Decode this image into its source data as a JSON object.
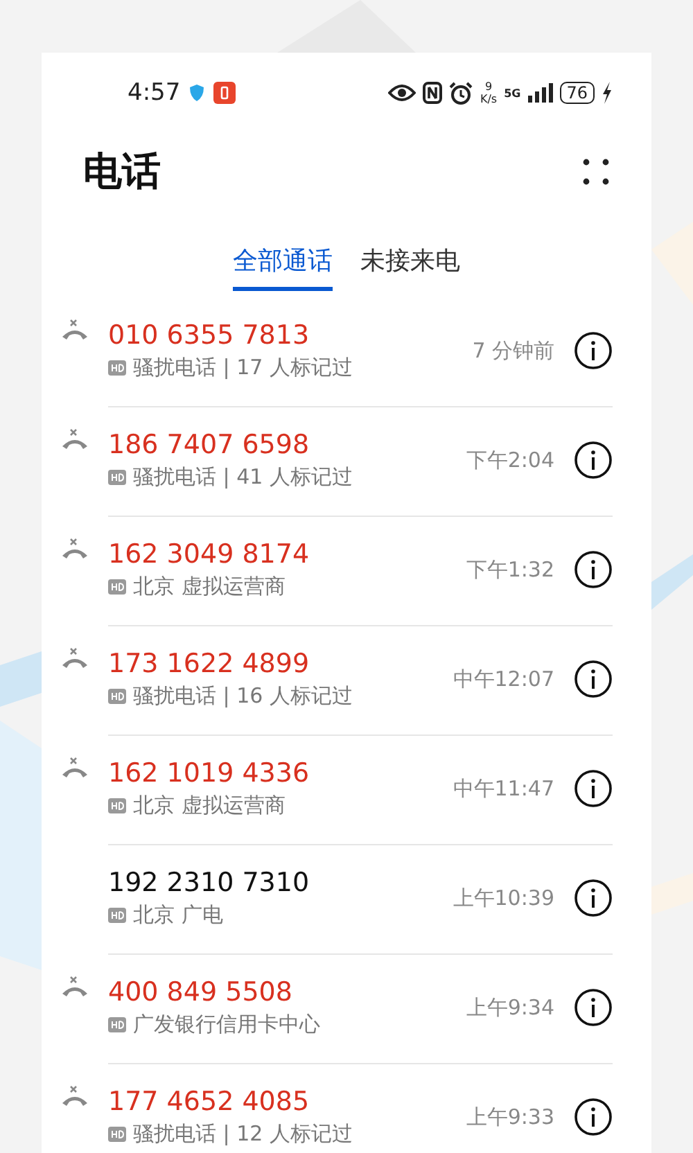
{
  "status_bar": {
    "time": "4:57",
    "speed_value": "9",
    "speed_unit": "K/s",
    "network": "5G",
    "battery": "76"
  },
  "title": "电话",
  "tabs": [
    {
      "label": "全部通话",
      "selected": true
    },
    {
      "label": "未接来电",
      "selected": false
    }
  ],
  "calls": [
    {
      "number": "010 6355 7813",
      "missed": true,
      "detail": "骚扰电话 | 17 人标记过",
      "time": "7 分钟前"
    },
    {
      "number": "186 7407 6598",
      "missed": true,
      "detail": "骚扰电话 | 41 人标记过",
      "time": "下午2:04"
    },
    {
      "number": "162 3049 8174",
      "missed": true,
      "detail": "北京 虚拟运营商",
      "time": "下午1:32"
    },
    {
      "number": "173 1622 4899",
      "missed": true,
      "detail": "骚扰电话 | 16 人标记过",
      "time": "中午12:07"
    },
    {
      "number": "162 1019 4336",
      "missed": true,
      "detail": "北京 虚拟运营商",
      "time": "中午11:47"
    },
    {
      "number": "192 2310 7310",
      "missed": false,
      "detail": "北京 广电",
      "time": "上午10:39"
    },
    {
      "number": "400 849 5508",
      "missed": true,
      "detail": "广发银行信用卡中心",
      "time": "上午9:34"
    },
    {
      "number": "177 4652 4085",
      "missed": true,
      "detail": "骚扰电话 | 12 人标记过",
      "time": "上午9:33"
    }
  ]
}
